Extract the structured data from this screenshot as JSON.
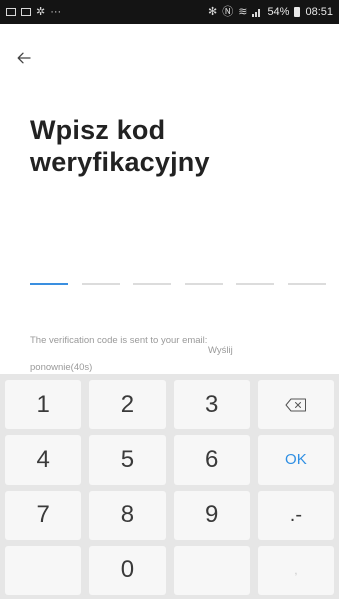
{
  "status_bar": {
    "battery": "54%",
    "time": "08:51",
    "left_icons": [
      "image-icon",
      "mail-icon",
      "settings-icon",
      "more-icon"
    ],
    "right_icons": [
      "bluetooth-icon",
      "nfc-icon",
      "wifi-icon",
      "signal-icon",
      "battery-icon"
    ]
  },
  "header": {
    "back_icon": "arrow-left-icon"
  },
  "title": {
    "line1": "Wpisz kod",
    "line2": "weryfikacyjny"
  },
  "code_input": {
    "slots": 6,
    "active_index": 0
  },
  "info": {
    "sent_text": "The verification code is sent to your email:",
    "resend_label": "Wyślij",
    "resend_countdown": "ponownie(40s)"
  },
  "keypad": {
    "keys": [
      {
        "label": "1"
      },
      {
        "label": "2"
      },
      {
        "label": "3"
      },
      {
        "label": "",
        "icon": "backspace-icon"
      },
      {
        "label": "4"
      },
      {
        "label": "5"
      },
      {
        "label": "6"
      },
      {
        "label": "OK"
      },
      {
        "label": "7"
      },
      {
        "label": "8"
      },
      {
        "label": "9"
      },
      {
        "label": ".-"
      },
      {
        "label": ""
      },
      {
        "label": "0"
      },
      {
        "label": ""
      },
      {
        "label": ","
      }
    ]
  },
  "colors": {
    "accent": "#3a8fe0",
    "status_bar_bg": "#141414",
    "keypad_bg": "#e6e6e6",
    "key_bg": "#f7f7f7"
  }
}
